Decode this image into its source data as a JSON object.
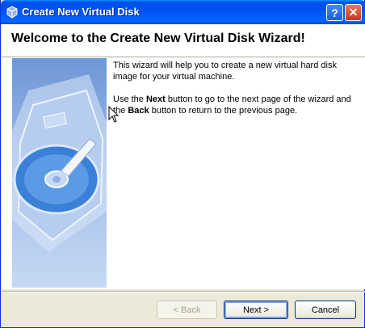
{
  "window": {
    "title": "Create New Virtual Disk"
  },
  "header": {
    "title": "Welcome to the Create New Virtual Disk Wizard!"
  },
  "body": {
    "para1": "This wizard will help you to create a new virtual hard disk image for your virtual machine.",
    "para2_pre": "Use the ",
    "para2_next": "Next",
    "para2_mid": " button to go to the next page of the wizard and the ",
    "para2_back": "Back",
    "para2_post": " button to return to the previous page."
  },
  "buttons": {
    "back": "< Back",
    "next": "Next >",
    "cancel": "Cancel",
    "help": "?",
    "close": "✕"
  },
  "colors": {
    "titlebar": "#0053ee",
    "dialog_bg": "#ece9d8",
    "side_panel": "#8fb0e2"
  },
  "icons": {
    "app": "virtualbox-cube-icon",
    "side_image": "hard-disk-illustration",
    "pointer": "mouse-cursor"
  }
}
